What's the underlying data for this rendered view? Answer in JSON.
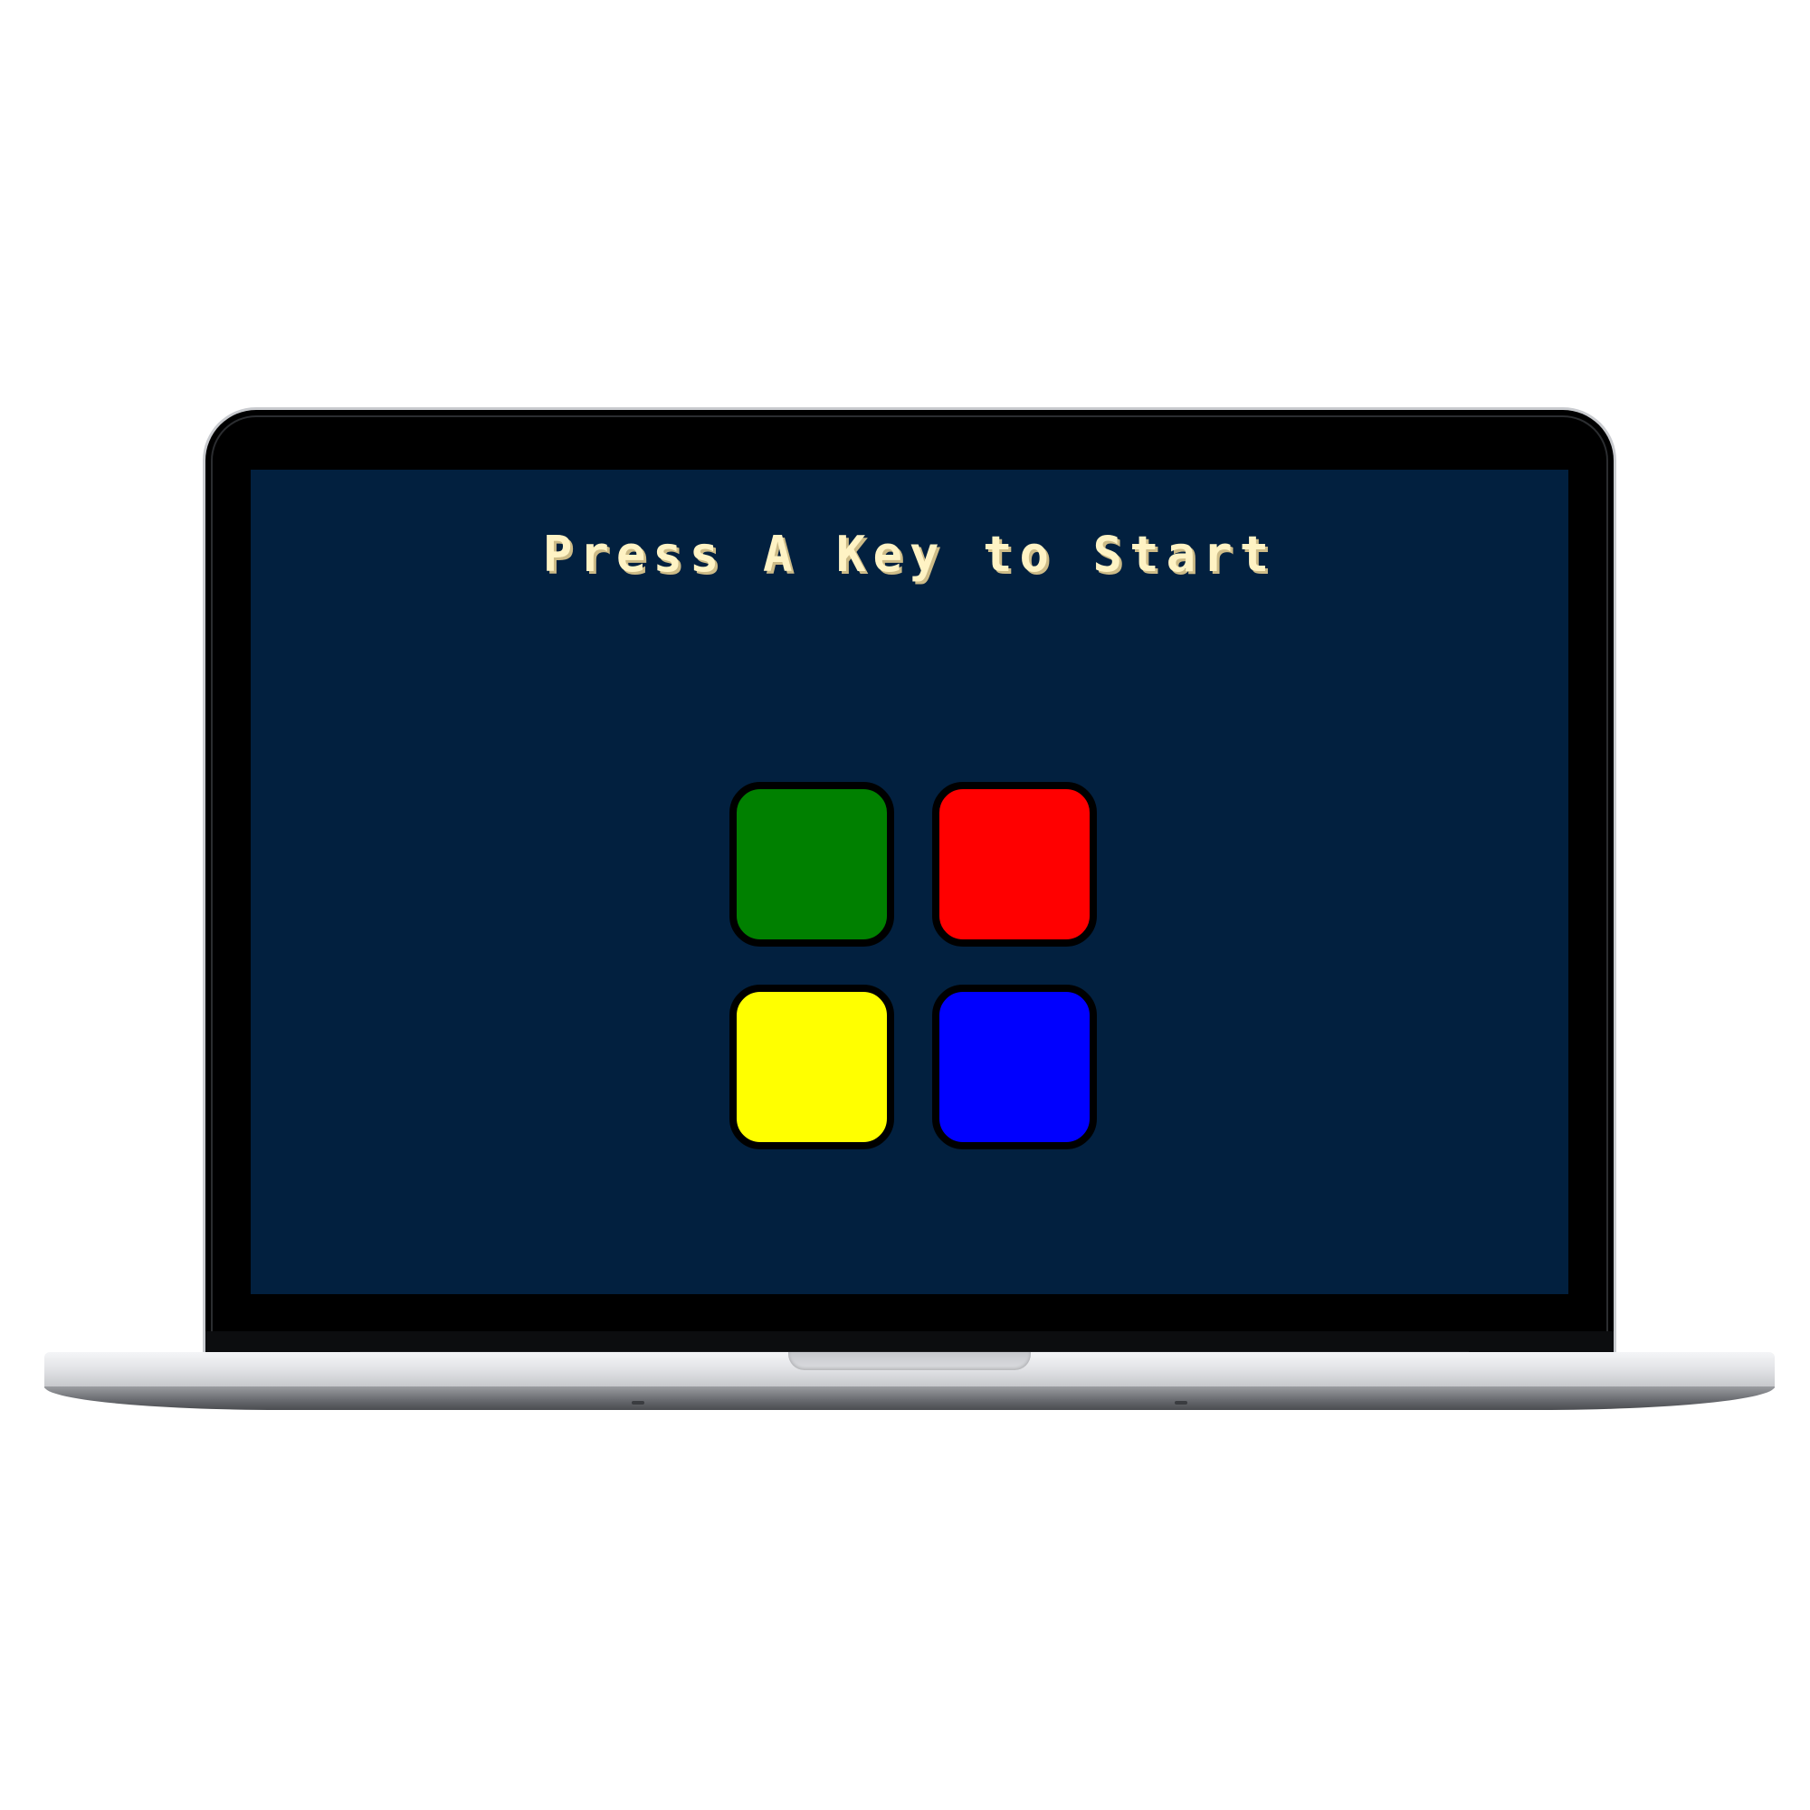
{
  "game": {
    "prompt": "Press A Key to Start",
    "pads": [
      {
        "name": "green",
        "color": "#008000"
      },
      {
        "name": "red",
        "color": "#ff0000"
      },
      {
        "name": "yellow",
        "color": "#ffff00"
      },
      {
        "name": "blue",
        "color": "#0000ff"
      }
    ]
  },
  "colors": {
    "screen_background": "#02203f",
    "prompt_text": "#fff3c4",
    "pad_border": "#000000"
  }
}
